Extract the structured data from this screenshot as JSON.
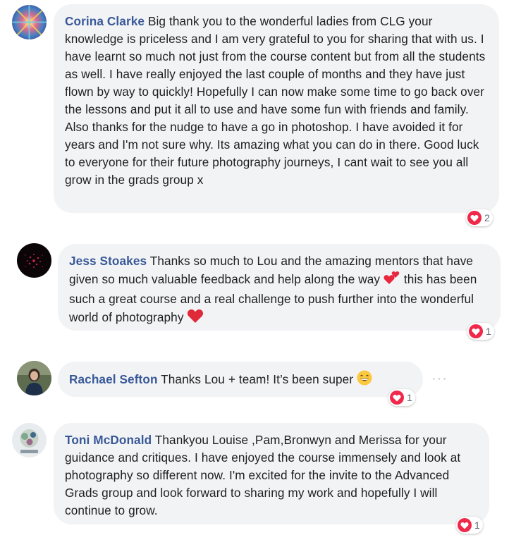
{
  "comments": [
    {
      "author": "Corina Clarke",
      "text": "Big thank you to the wonderful ladies from CLG your knowledge is priceless and I am very grateful to you for sharing that with us. I have learnt so much not just from the course content but from all the students as well. I have really enjoyed the last couple of months and they have just flown by way to quickly! Hopefully I can now make some time to go back over the lessons and put it all to use and have some fun with friends and family. Also thanks for the nudge to have a go in photoshop. I have avoided it for years and I'm not sure why. Its amazing what you can do in there. Good luck to everyone for their future photography journeys, I cant wait to see you all grow in the grads group x",
      "reaction_icon": "love-icon",
      "reaction_count": "2"
    },
    {
      "author": "Jess Stoakes",
      "text_part1": "Thanks so much to Lou and the amazing mentors that have given so much valuable feedback and help along the way",
      "text_part2": "this has been such a great course and a real challenge to push further into the wonderful world of photography",
      "emojis": [
        "two-hearts-emoji",
        "red-heart-emoji"
      ],
      "reaction_icon": "love-icon",
      "reaction_count": "1"
    },
    {
      "author": "Rachael Sefton",
      "text": "Thanks Lou + team! It’s been super",
      "emojis": [
        "grinning-smiling-eyes-emoji"
      ],
      "reaction_icon": "love-icon",
      "reaction_count": "1",
      "more_label": "···"
    },
    {
      "author": "Toni McDonald",
      "text": "Thankyou Louise ,Pam,Bronwyn and Merissa for your guidance and critiques. I have enjoyed the course immensely and look at photography so different now. I'm excited for the invite to the Advanced Grads group and look forward to sharing my work and hopefully I will continue to grow.",
      "reaction_icon": "love-icon",
      "reaction_count": "1"
    }
  ],
  "colors": {
    "author_name": "#385898",
    "bubble_bg": "#f2f3f5",
    "love_red": "#f0284a",
    "text": "#1c1e21",
    "count_gray": "#606770"
  }
}
